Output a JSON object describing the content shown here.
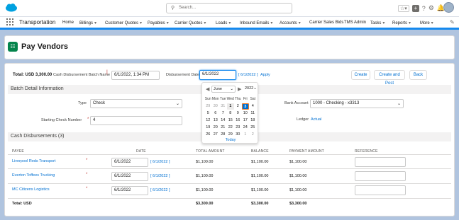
{
  "header": {
    "search_placeholder": "Search...",
    "icons": [
      "favorites-icon",
      "add-icon",
      "help-icon",
      "setup-gear-icon",
      "notification-bell-icon",
      "avatar"
    ]
  },
  "nav": {
    "app_name": "Transportation",
    "items": [
      {
        "label": "Home",
        "dropdown": false
      },
      {
        "label": "Billings",
        "dropdown": true
      },
      {
        "label": "Customer Quotes",
        "dropdown": true
      },
      {
        "label": "Payables",
        "dropdown": true
      },
      {
        "label": "Carrier Quotes",
        "dropdown": true
      },
      {
        "label": "Loads",
        "dropdown": true
      },
      {
        "label": "Inbound Emails",
        "dropdown": true
      },
      {
        "label": "Accounts",
        "dropdown": true
      },
      {
        "label": "Carrier Sales Bids",
        "dropdown": false
      },
      {
        "label": "TMS Admin",
        "dropdown": false
      },
      {
        "label": "Tasks",
        "dropdown": true
      },
      {
        "label": "Reports",
        "dropdown": true
      },
      {
        "label": "More",
        "dropdown": true
      }
    ]
  },
  "page": {
    "title": "Pay Vendors"
  },
  "batch": {
    "total_label": "Total: USD 3,300.00",
    "batch_name_label": "Cash Disbursement Batch Name",
    "batch_name_value": "6/1/2022, 1:34 PM",
    "disb_date_label": "Disbursement Date",
    "disb_date_value": "6/1/2022",
    "disb_date_link": "[ 6/1/2022 ]",
    "apply_label": "Apply",
    "create_btn": "Create",
    "create_post_btn": "Create and Post",
    "back_btn": "Back"
  },
  "detail": {
    "section_title": "Batch Detail Information",
    "type_label": "Type",
    "type_value": "Check",
    "check_num_label": "Starting Check Number",
    "check_num_value": "4",
    "bank_label": "Bank Account",
    "bank_value": "1000 - Checking - x3313",
    "ledger_label": "Ledger",
    "ledger_value": "Actual"
  },
  "datepicker": {
    "month": "June",
    "year": "2022",
    "dow": [
      "Sun",
      "Mon",
      "Tue",
      "Wed",
      "Thu",
      "Fri",
      "Sat"
    ],
    "days": [
      "29",
      "30",
      "31",
      "1",
      "2",
      "3",
      "4",
      "5",
      "6",
      "7",
      "8",
      "9",
      "10",
      "11",
      "12",
      "13",
      "14",
      "15",
      "16",
      "17",
      "18",
      "19",
      "20",
      "21",
      "22",
      "23",
      "24",
      "25",
      "26",
      "27",
      "28",
      "29",
      "30",
      "1",
      "2"
    ],
    "today_label": "Today",
    "prev_icon": "chevron-left-icon",
    "next_icon": "chevron-right-icon"
  },
  "disbursements": {
    "section_title": "Cash Disbursements (3)",
    "columns": [
      "PAYEE",
      "DATE",
      "TOTAL AMOUNT",
      "BALANCE",
      "PAYMENT AMOUNT",
      "REFERENCE"
    ],
    "rows": [
      {
        "payee": "Liverpool Reds Transport",
        "date": "6/1/2022",
        "date_link": "[ 6/1/2022 ]",
        "total": "$1,100.00",
        "balance": "$1,100.00",
        "payment": "$1,100.00"
      },
      {
        "payee": "Everton Toffees Trucking",
        "date": "6/1/2022",
        "date_link": "[ 6/1/2022 ]",
        "total": "$1,100.00",
        "balance": "$1,100.00",
        "payment": "$1,100.00"
      },
      {
        "payee": "MC Citizens Logistics",
        "date": "6/1/2022",
        "date_link": "[ 6/1/2022 ]",
        "total": "$1,100.00",
        "balance": "$1,100.00",
        "payment": "$1,100.00"
      }
    ],
    "total_row": {
      "label": "Total: USD",
      "total": "$3,300.00",
      "balance": "$3,300.00",
      "payment": "$3,300.00"
    }
  }
}
